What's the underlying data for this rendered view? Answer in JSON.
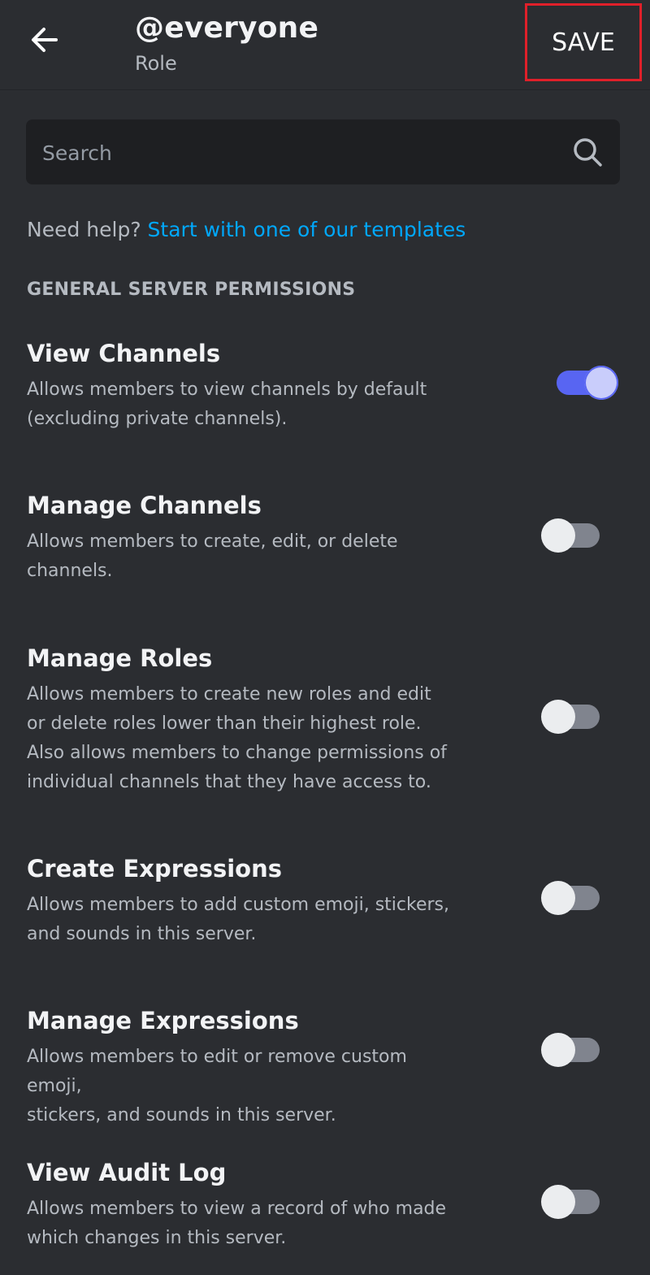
{
  "header": {
    "title": "@everyone",
    "subtitle": "Role",
    "save_label": "SAVE",
    "back_icon": "arrow-left-icon"
  },
  "search": {
    "placeholder": "Search",
    "value": "",
    "icon": "search-icon"
  },
  "help": {
    "prefix": "Need help? ",
    "link_label": "Start with one of our templates"
  },
  "section": {
    "title": "GENERAL SERVER PERMISSIONS"
  },
  "permissions": [
    {
      "title": "View Channels",
      "description": "Allows members to view channels by default\n(excluding private channels).",
      "enabled": true
    },
    {
      "title": "Manage Channels",
      "description": "Allows members to create, edit, or delete\nchannels.",
      "enabled": false
    },
    {
      "title": "Manage Roles",
      "description": "Allows members to create new roles and edit\nor delete roles lower than their highest role.\nAlso allows members to change permissions of\nindividual channels that they have access to.",
      "enabled": false
    },
    {
      "title": "Create Expressions",
      "description": "Allows members to add custom emoji, stickers,\nand sounds in this server.",
      "enabled": false
    },
    {
      "title": "Manage Expressions",
      "description": "Allows members to edit or remove custom emoji,\nstickers, and sounds in this server.",
      "enabled": false
    },
    {
      "title": "View Audit Log",
      "description": "Allows members to view a record of who made\nwhich changes in this server.",
      "enabled": false
    }
  ],
  "colors": {
    "background": "#2b2d31",
    "search_bg": "#1e1f22",
    "link": "#00a8fc",
    "toggle_on": "#5865f2",
    "toggle_off": "#80848e",
    "save_highlight": "#e0202a"
  }
}
